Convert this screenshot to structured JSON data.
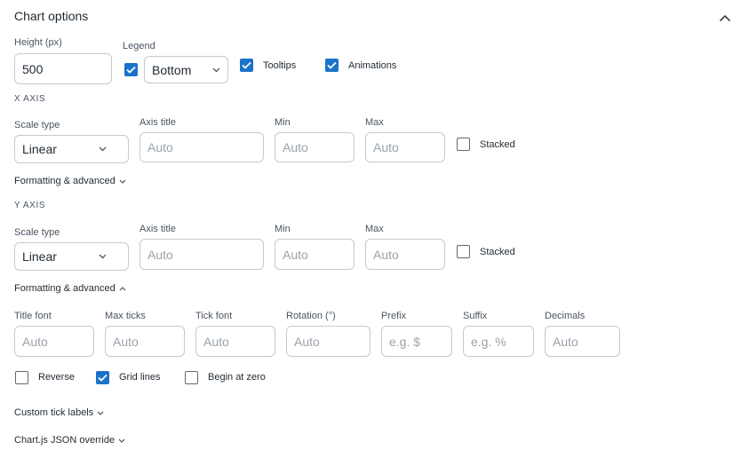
{
  "panel": {
    "title": "Chart options"
  },
  "general": {
    "height_label": "Height (px)",
    "height_value": "500",
    "legend_label": "Legend",
    "legend_checked": true,
    "legend_position": "Bottom",
    "tooltips_label": "Tooltips",
    "tooltips_checked": true,
    "animations_label": "Animations",
    "animations_checked": true
  },
  "x_axis": {
    "heading": "X AXIS",
    "scale_type_label": "Scale type",
    "scale_type_value": "Linear",
    "axis_title_label": "Axis title",
    "axis_title_placeholder": "Auto",
    "min_label": "Min",
    "min_placeholder": "Auto",
    "max_label": "Max",
    "max_placeholder": "Auto",
    "stacked_label": "Stacked",
    "stacked_checked": false,
    "advanced_label": "Formatting & advanced",
    "advanced_expanded": false
  },
  "y_axis": {
    "heading": "Y AXIS",
    "scale_type_label": "Scale type",
    "scale_type_value": "Linear",
    "axis_title_label": "Axis title",
    "axis_title_placeholder": "Auto",
    "min_label": "Min",
    "min_placeholder": "Auto",
    "max_label": "Max",
    "max_placeholder": "Auto",
    "stacked_label": "Stacked",
    "stacked_checked": false,
    "advanced_label": "Formatting & advanced",
    "advanced_expanded": true,
    "advanced": {
      "title_font_label": "Title font",
      "title_font_placeholder": "Auto",
      "max_ticks_label": "Max ticks",
      "max_ticks_placeholder": "Auto",
      "tick_font_label": "Tick font",
      "tick_font_placeholder": "Auto",
      "rotation_label": "Rotation (°)",
      "rotation_placeholder": "Auto",
      "prefix_label": "Prefix",
      "prefix_placeholder": "e.g. $",
      "suffix_label": "Suffix",
      "suffix_placeholder": "e.g. %",
      "decimals_label": "Decimals",
      "decimals_placeholder": "Auto",
      "reverse_label": "Reverse",
      "reverse_checked": false,
      "grid_lines_label": "Grid lines",
      "grid_lines_checked": true,
      "begin_at_zero_label": "Begin at zero",
      "begin_at_zero_checked": false
    }
  },
  "custom_tick_labels": "Custom tick labels",
  "json_override": "Chart.js JSON override",
  "colors": {
    "accent": "#1a73c8",
    "border": "#c4cad0",
    "text": "#1f2933",
    "muted": "#4a5560",
    "placeholder": "#9aa3ab"
  }
}
